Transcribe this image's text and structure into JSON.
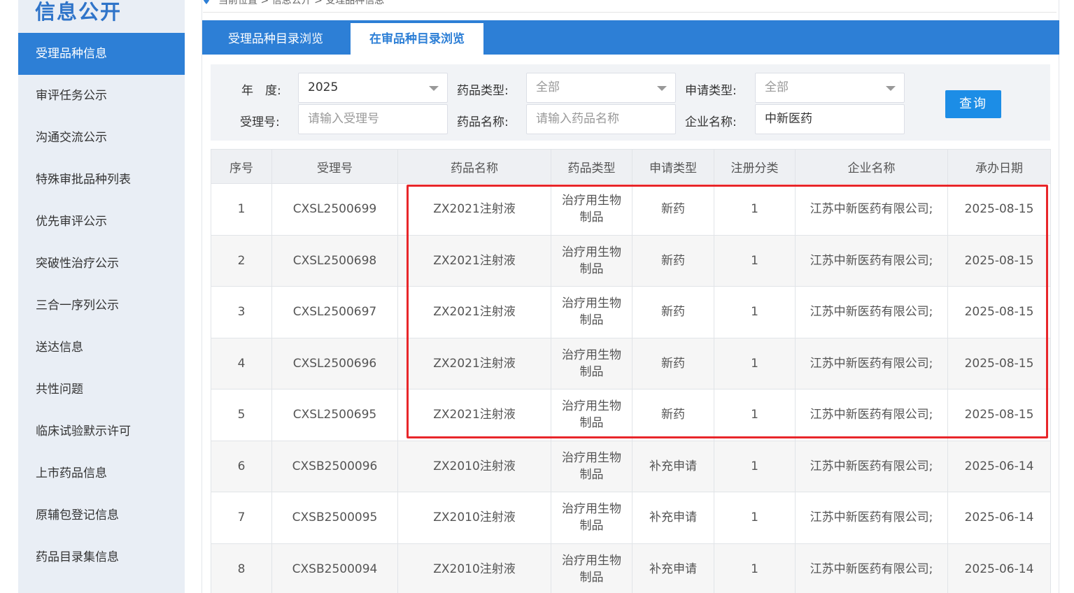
{
  "sidebar": {
    "title": "信息公开",
    "items": [
      {
        "label": "受理品种信息",
        "active": true
      },
      {
        "label": "审评任务公示"
      },
      {
        "label": "沟通交流公示"
      },
      {
        "label": "特殊审批品种列表"
      },
      {
        "label": "优先审评公示"
      },
      {
        "label": "突破性治疗公示"
      },
      {
        "label": "三合一序列公示"
      },
      {
        "label": "送达信息"
      },
      {
        "label": "共性问题"
      },
      {
        "label": "临床试验默示许可"
      },
      {
        "label": "上市药品信息"
      },
      {
        "label": "原辅包登记信息"
      },
      {
        "label": "药品目录集信息"
      }
    ]
  },
  "breadcrumb": {
    "text": "当前位置 > 信息公开 > 受理品种信息"
  },
  "tabs": [
    {
      "label": "受理品种目录浏览"
    },
    {
      "label": "在审品种目录浏览",
      "active": true
    }
  ],
  "filters": {
    "year_label": "年　度:",
    "year_value": "2025",
    "drug_type_label": "药品类型:",
    "drug_type_value": "全部",
    "apply_type_label": "申请类型:",
    "apply_type_value": "全部",
    "accept_no_label": "受理号:",
    "accept_no_placeholder": "请输入受理号",
    "drug_name_label": "药品名称:",
    "drug_name_placeholder": "请输入药品名称",
    "company_label": "企业名称:",
    "company_value": "中新医药",
    "query_label": "查询"
  },
  "table": {
    "headers": [
      "序号",
      "受理号",
      "药品名称",
      "药品类型",
      "申请类型",
      "注册分类",
      "企业名称",
      "承办日期"
    ],
    "rows": [
      [
        "1",
        "CXSL2500699",
        "ZX2021注射液",
        "治疗用生物制品",
        "新药",
        "1",
        "江苏中新医药有限公司;",
        "2025-08-15"
      ],
      [
        "2",
        "CXSL2500698",
        "ZX2021注射液",
        "治疗用生物制品",
        "新药",
        "1",
        "江苏中新医药有限公司;",
        "2025-08-15"
      ],
      [
        "3",
        "CXSL2500697",
        "ZX2021注射液",
        "治疗用生物制品",
        "新药",
        "1",
        "江苏中新医药有限公司;",
        "2025-08-15"
      ],
      [
        "4",
        "CXSL2500696",
        "ZX2021注射液",
        "治疗用生物制品",
        "新药",
        "1",
        "江苏中新医药有限公司;",
        "2025-08-15"
      ],
      [
        "5",
        "CXSL2500695",
        "ZX2021注射液",
        "治疗用生物制品",
        "新药",
        "1",
        "江苏中新医药有限公司;",
        "2025-08-15"
      ],
      [
        "6",
        "CXSB2500096",
        "ZX2010注射液",
        "治疗用生物制品",
        "补充申请",
        "1",
        "江苏中新医药有限公司;",
        "2025-06-14"
      ],
      [
        "7",
        "CXSB2500095",
        "ZX2010注射液",
        "治疗用生物制品",
        "补充申请",
        "1",
        "江苏中新医药有限公司;",
        "2025-06-14"
      ],
      [
        "8",
        "CXSB2500094",
        "ZX2010注射液",
        "治疗用生物制品",
        "补充申请",
        "1",
        "江苏中新医药有限公司;",
        "2025-06-14"
      ]
    ]
  },
  "colors": {
    "accent": "#2d7fd6",
    "highlight": "#e8262a"
  }
}
